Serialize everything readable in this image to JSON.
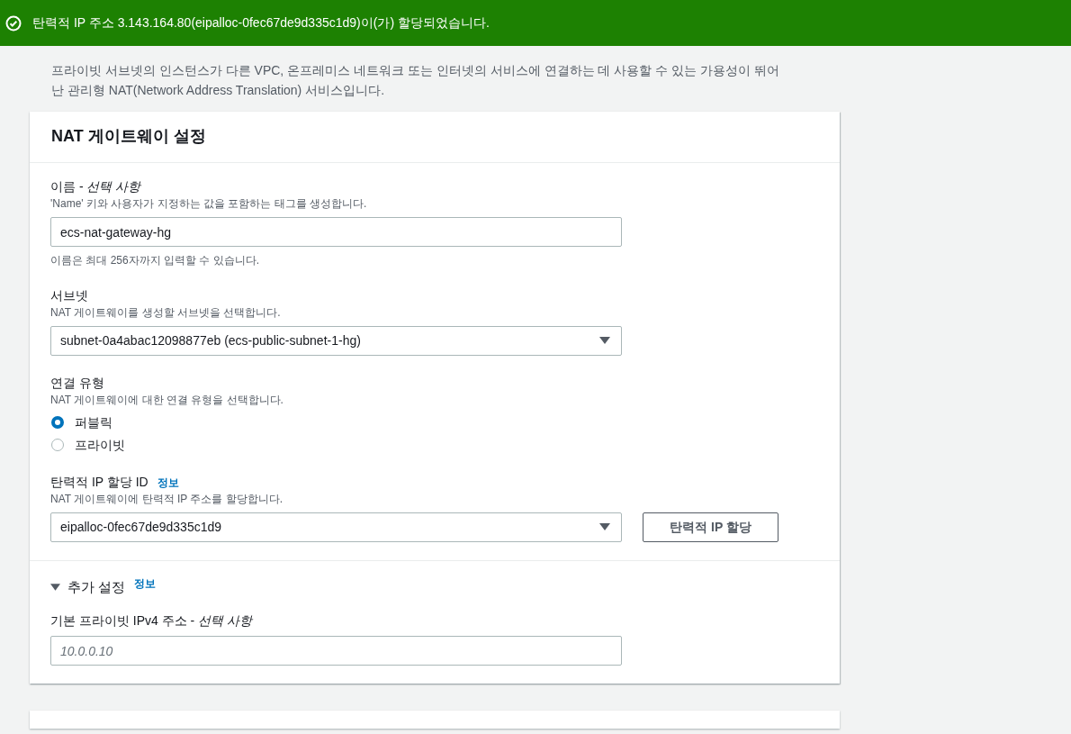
{
  "flash": {
    "message": "탄력적 IP 주소 3.143.164.80(eipalloc-0fec67de9d335c1d9)이(가) 할당되었습니다."
  },
  "description": "프라이빗 서브넷의 인스턴스가 다른 VPC, 온프레미스 네트워크 또는 인터넷의 서비스에 연결하는 데 사용할 수 있는 가용성이 뛰어난 관리형 NAT(Network Address Translation) 서비스입니다.",
  "panel": {
    "title": "NAT 게이트웨이 설정",
    "fields": [
      {
        "kind": "text",
        "label": "이름 - *선택 사항*",
        "description": "'Name' 키와 사용자가 지정하는 값을 포함하는 태그를 생성합니다.",
        "value": "ecs-nat-gateway-hg",
        "constraint": "이름은 최대 256자까지 입력할 수 있습니다."
      },
      {
        "kind": "select",
        "label": "서브넷",
        "description": "NAT 게이트웨이를 생성할 서브넷을 선택합니다.",
        "value": "subnet-0a4abac12098877eb (ecs-public-subnet-1-hg)"
      },
      {
        "kind": "radio",
        "label": "연결 유형",
        "description": "NAT 게이트웨이에 대한 연결 유형을 선택합니다.",
        "options": [
          {
            "label": "퍼블릭",
            "selected": true
          },
          {
            "label": "프라이빗",
            "selected": false
          }
        ]
      },
      {
        "kind": "select",
        "label": "탄력적 IP 할당 ID",
        "info": "정보",
        "description": "NAT 게이트웨이에 탄력적 IP 주소를 할당합니다.",
        "value": "eipalloc-0fec67de9d335c1d9",
        "button": "탄력적 IP 할당"
      }
    ],
    "additional": {
      "title": "추가 설정",
      "info": "정보",
      "expanded": true,
      "fields": [
        {
          "kind": "text",
          "label": "기본 프라이빗 IPv4 주소 - *선택 사항*",
          "placeholder": "10.0.0.10"
        }
      ]
    }
  }
}
